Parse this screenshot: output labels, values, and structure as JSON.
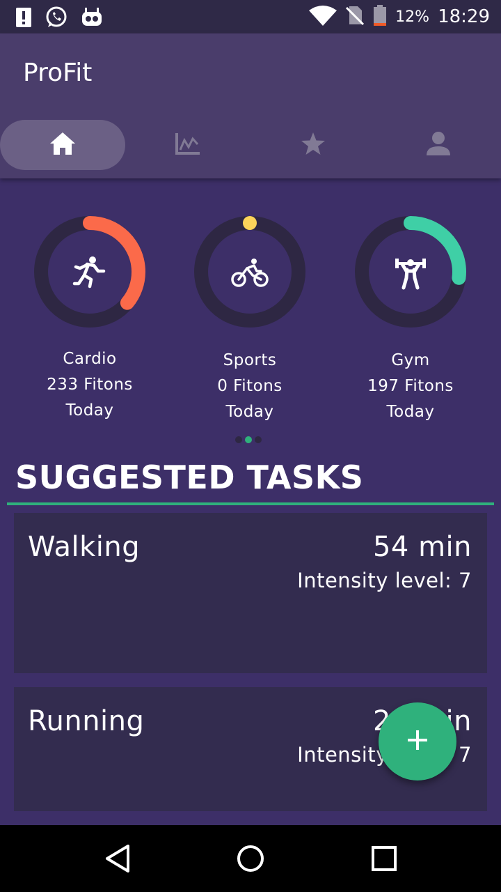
{
  "status_bar": {
    "battery": "12%",
    "time": "18:29"
  },
  "app": {
    "title": "ProFit"
  },
  "tabs": [
    {
      "icon": "home-icon",
      "active": true
    },
    {
      "icon": "chart-icon",
      "active": false
    },
    {
      "icon": "star-icon",
      "active": false
    },
    {
      "icon": "person-icon",
      "active": false
    }
  ],
  "categories": [
    {
      "name": "Cardio",
      "fitons": "233 Fitons",
      "period": "Today",
      "icon": "running-icon",
      "color": "#fb6a4a",
      "progress": 0.36
    },
    {
      "name": "Sports",
      "fitons": "0 Fitons",
      "period": "Today",
      "icon": "cycling-icon",
      "color": "#fcd45a",
      "progress": 0
    },
    {
      "name": "Gym",
      "fitons": "197 Fitons",
      "period": "Today",
      "icon": "weightlifting-icon",
      "color": "#3fcfa6",
      "progress": 0.27
    }
  ],
  "pager": {
    "pages": 3,
    "active": 1
  },
  "section": {
    "title": "SUGGESTED TASKS"
  },
  "tasks": [
    {
      "name": "Walking",
      "duration": "54 min",
      "intensity": "Intensity level: 7"
    },
    {
      "name": "Running",
      "duration": "28 min",
      "intensity": "Intensity level: 7"
    }
  ],
  "fab": {
    "icon": "plus-icon"
  },
  "colors": {
    "accent": "#2fb17c",
    "background": "#3d2f68",
    "card": "#332c4f",
    "appbar": "#4a3d6b"
  }
}
